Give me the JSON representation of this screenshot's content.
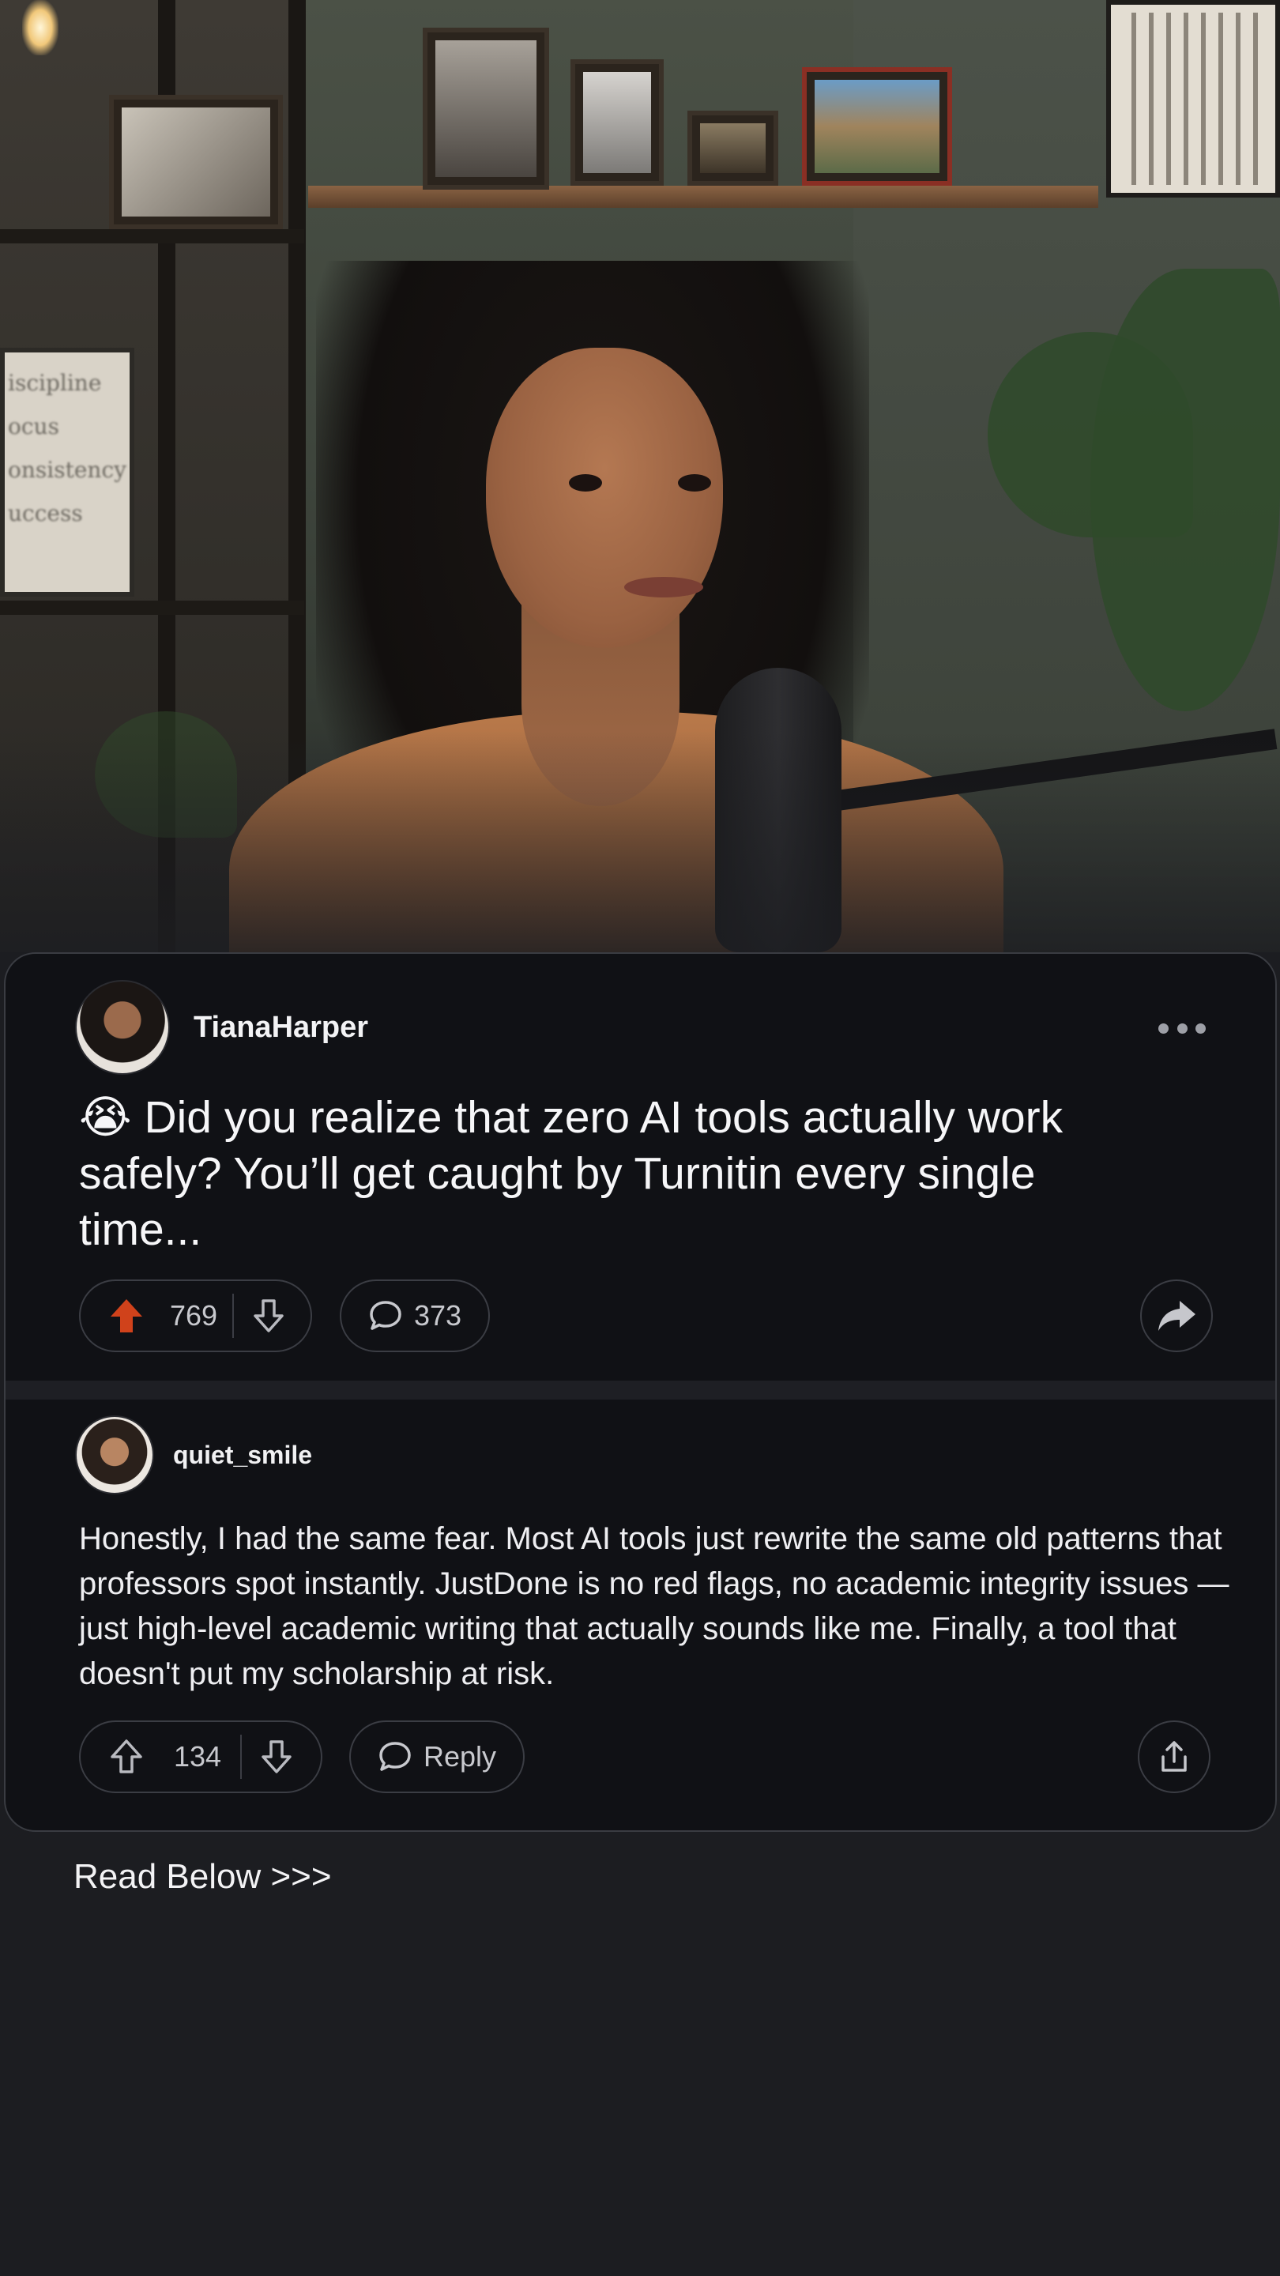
{
  "post": {
    "author": "TianaHarper",
    "emoji": "😭",
    "title": "Did you realize that zero AI tools actually work safely? You’ll get caught by Turnitin every single time...",
    "upvotes": "769",
    "comments": "373",
    "upvoted": true
  },
  "reply": {
    "author": "quiet_smile",
    "body": "Honestly, I had the same fear. Most AI tools just rewrite the same old patterns that professors spot instantly. JustDone is no red flags, no academic integrity issues — just high-level academic writing that actually sounds like me. Finally, a tool that doesn't put my scholarship at risk.",
    "upvotes": "134",
    "reply_label": "Reply"
  },
  "footer": {
    "cta": "Read Below >>>"
  },
  "hero": {
    "sign_lines": [
      "iscipline",
      "ocus",
      "onsistency",
      "uccess"
    ]
  },
  "colors": {
    "card_bg": "#101115",
    "page_bg": "#1c1d21",
    "upvote_active": "#d0421b",
    "icon_muted": "#b9bac0"
  }
}
